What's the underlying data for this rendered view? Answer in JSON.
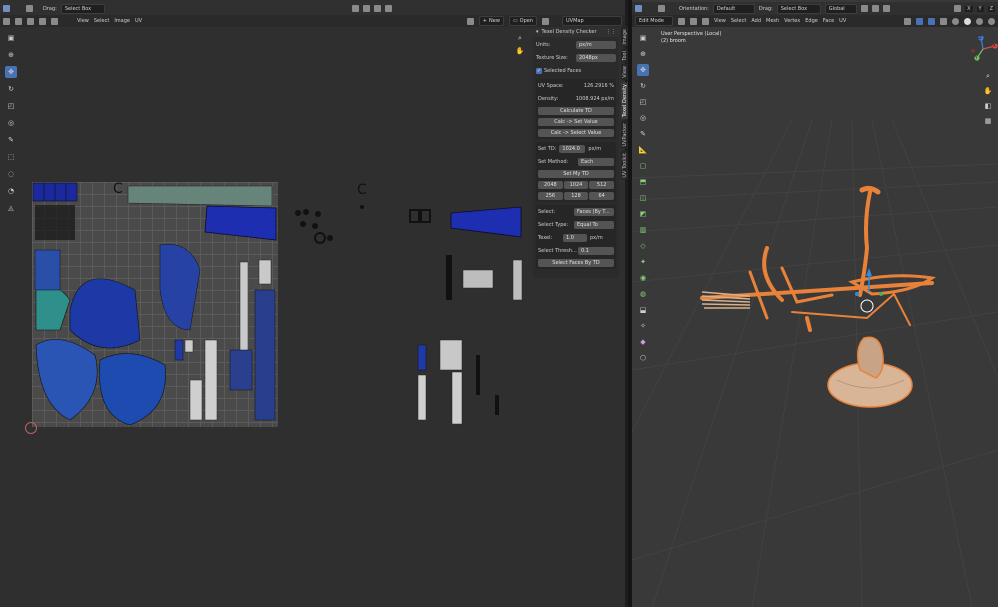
{
  "uv_editor": {
    "header": {
      "drag_label": "Drag:",
      "select_mode": "Select Box",
      "menus": [
        "View",
        "Select",
        "Image",
        "UV"
      ],
      "new_label": "New",
      "open_label": "Open",
      "uvmap_name": "UVMap"
    },
    "texel_panel": {
      "title": "Texel Density Checker",
      "units_label": "Units:",
      "units_value": "px/m",
      "texture_size_label": "Texture Size:",
      "texture_size_value": "2048px",
      "selected_faces_label": "Selected Faces",
      "uv_space_label": "UV Space:",
      "uv_space_value": "126.2916 %",
      "density_label": "Density:",
      "density_value": "1008.924 px/m",
      "calculate_label": "Calculate TD",
      "calc_set_value_label": "Calc -> Set Value",
      "calc_select_value_label": "Calc -> Select Value",
      "set_td_label": "Set TD:",
      "set_td_value": "1024.0",
      "set_td_unit": "px/m",
      "set_method_label": "Set Method:",
      "set_method_value": "Each",
      "set_my_td_label": "Set My TD",
      "presets_row1": [
        "2048",
        "1024",
        "512"
      ],
      "presets_row2": [
        "256",
        "128",
        "64"
      ],
      "select_label": "Select:",
      "select_value": "Faces (By T...",
      "select_type_label": "Select Type:",
      "select_type_value": "Equal To",
      "texel_label": "Texel:",
      "texel_value": "1.0",
      "texel_unit": "px/m",
      "threshold_label": "Select Thresh...",
      "threshold_value": "0.1",
      "select_faces_label": "Select Faces By TD"
    },
    "side_tabs": [
      "Image",
      "Tool",
      "View",
      "Texel Density",
      "UVPacker",
      "UV Toolkit"
    ]
  },
  "viewport": {
    "header": {
      "orientation_label": "Orientation:",
      "orientation_value": "Default",
      "drag_label": "Drag:",
      "select_mode": "Select Box",
      "transform_space": "Global",
      "axes": [
        "X",
        "Y",
        "Z"
      ]
    },
    "subheader": {
      "mode": "Edit Mode",
      "menus": [
        "View",
        "Select",
        "Add",
        "Mesh",
        "Vertex",
        "Edge",
        "Face",
        "UV"
      ]
    },
    "overlay_title": "User Perspective (Local)",
    "overlay_object": "(2) broom",
    "gizmo_axes": [
      "X",
      "Y",
      "Z"
    ]
  },
  "colors": {
    "accent": "#4772b3",
    "mesh_orange": "#e8823a",
    "uv_blue": "#1c2fa8"
  }
}
